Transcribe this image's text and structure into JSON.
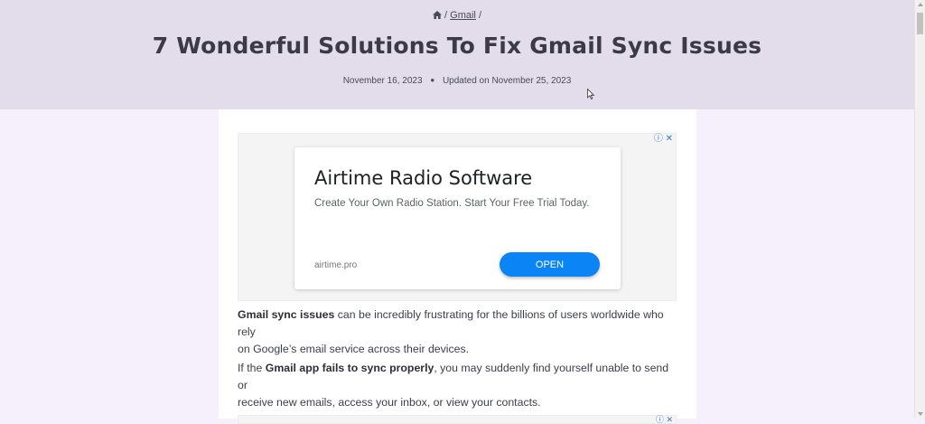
{
  "breadcrumb": {
    "home_icon": "home-icon",
    "separator": "/",
    "category": "Gmail"
  },
  "article": {
    "title": "7 Wonderful Solutions To Fix Gmail Sync Issues",
    "published": "November 16, 2023",
    "updated": "Updated on November 25, 2023",
    "paragraph1": {
      "bold": "Gmail sync issues",
      "rest_line1": " can be incredibly frustrating for the billions of users worldwide who rely",
      "line2": "on Google’s email service across their devices."
    },
    "paragraph2": {
      "prefix": "If the ",
      "bold": "Gmail app fails to sync properly",
      "rest_line1": ", you may suddenly find yourself unable to send or",
      "line2": "receive new emails, access your inbox, or view your contacts."
    }
  },
  "ad": {
    "info_icon": "info-icon",
    "close_icon": "close-icon",
    "headline": "Airtime Radio Software",
    "description": "Create Your Own Radio Station. Start Your Free Trial Today.",
    "domain": "airtime.pro",
    "cta": "OPEN"
  },
  "colors": {
    "hero_bg": "#e2dceb",
    "page_bg": "#f5f0fc",
    "cta_blue": "#0b84f5"
  }
}
